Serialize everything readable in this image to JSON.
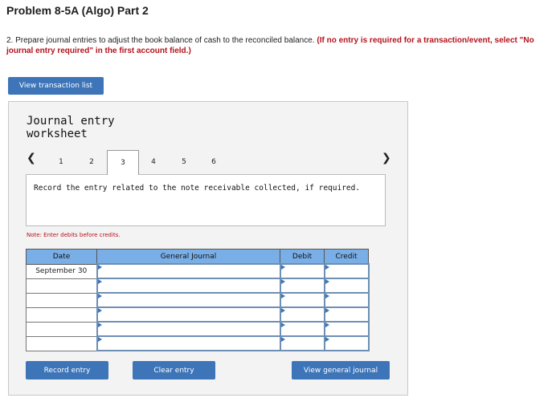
{
  "header": {
    "title": "Problem 8-5A (Algo) Part 2",
    "instruction": "2. Prepare journal entries to adjust the book balance of cash to the reconciled balance.",
    "instruction_note": "(If no entry is required for a transaction/event, select \"No journal entry required\" in the first account field.)"
  },
  "buttons": {
    "view_transaction_list": "View transaction list",
    "record_entry": "Record entry",
    "clear_entry": "Clear entry",
    "view_general_journal": "View general journal"
  },
  "worksheet": {
    "title_line1": "Journal entry",
    "title_line2": "worksheet",
    "prev_icon": "chevron-left",
    "next_icon": "chevron-right",
    "tabs": [
      "1",
      "2",
      "3",
      "4",
      "5",
      "6"
    ],
    "active_tab": "3",
    "prompt": "Record the entry related to the note receivable collected, if required.",
    "note": "Note: Enter debits before credits."
  },
  "table": {
    "columns": [
      "Date",
      "General Journal",
      "Debit",
      "Credit"
    ],
    "rows": [
      {
        "date": "September 30",
        "account": "",
        "debit": "",
        "credit": ""
      },
      {
        "date": "",
        "account": "",
        "debit": "",
        "credit": ""
      },
      {
        "date": "",
        "account": "",
        "debit": "",
        "credit": ""
      },
      {
        "date": "",
        "account": "",
        "debit": "",
        "credit": ""
      },
      {
        "date": "",
        "account": "",
        "debit": "",
        "credit": ""
      },
      {
        "date": "",
        "account": "",
        "debit": "",
        "credit": ""
      }
    ]
  },
  "colors": {
    "button_blue": "#3d75b8",
    "header_blue": "#7aaee6",
    "warning_red": "#b5121b"
  }
}
